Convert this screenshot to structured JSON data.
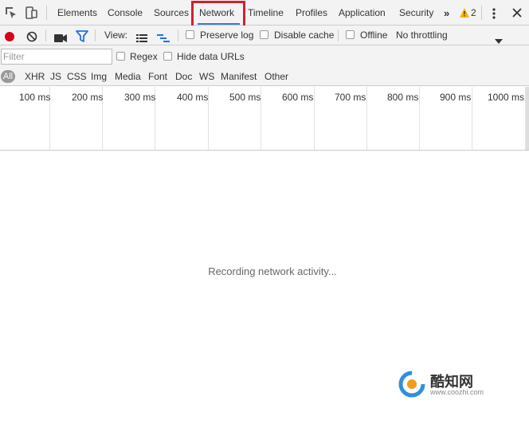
{
  "tabs": [
    "Elements",
    "Console",
    "Sources",
    "Network",
    "Timeline",
    "Profiles",
    "Application",
    "Security"
  ],
  "active_tab": "Network",
  "more_label": "»",
  "warning_count": "2",
  "toolbar": {
    "view_label": "View:",
    "preserve_log": "Preserve log",
    "disable_cache": "Disable cache",
    "offline": "Offline",
    "throttling": "No throttling"
  },
  "filter": {
    "placeholder": "Filter",
    "regex": "Regex",
    "hide_data_urls": "Hide data URLs"
  },
  "types": [
    "All",
    "XHR",
    "JS",
    "CSS",
    "Img",
    "Media",
    "Font",
    "Doc",
    "WS",
    "Manifest",
    "Other"
  ],
  "timeline_ticks": [
    "100 ms",
    "200 ms",
    "300 ms",
    "400 ms",
    "500 ms",
    "600 ms",
    "700 ms",
    "800 ms",
    "900 ms",
    "1000 ms"
  ],
  "status": "Recording network activity...",
  "watermark": {
    "title": "酷知网",
    "url": "www.coozhi.com"
  },
  "colors": {
    "record": "#d9001b",
    "filter_icon": "#1a73e8",
    "tab_underline": "#3879d9",
    "highlight_box": "#d0202f",
    "warning": "#f4b400"
  }
}
